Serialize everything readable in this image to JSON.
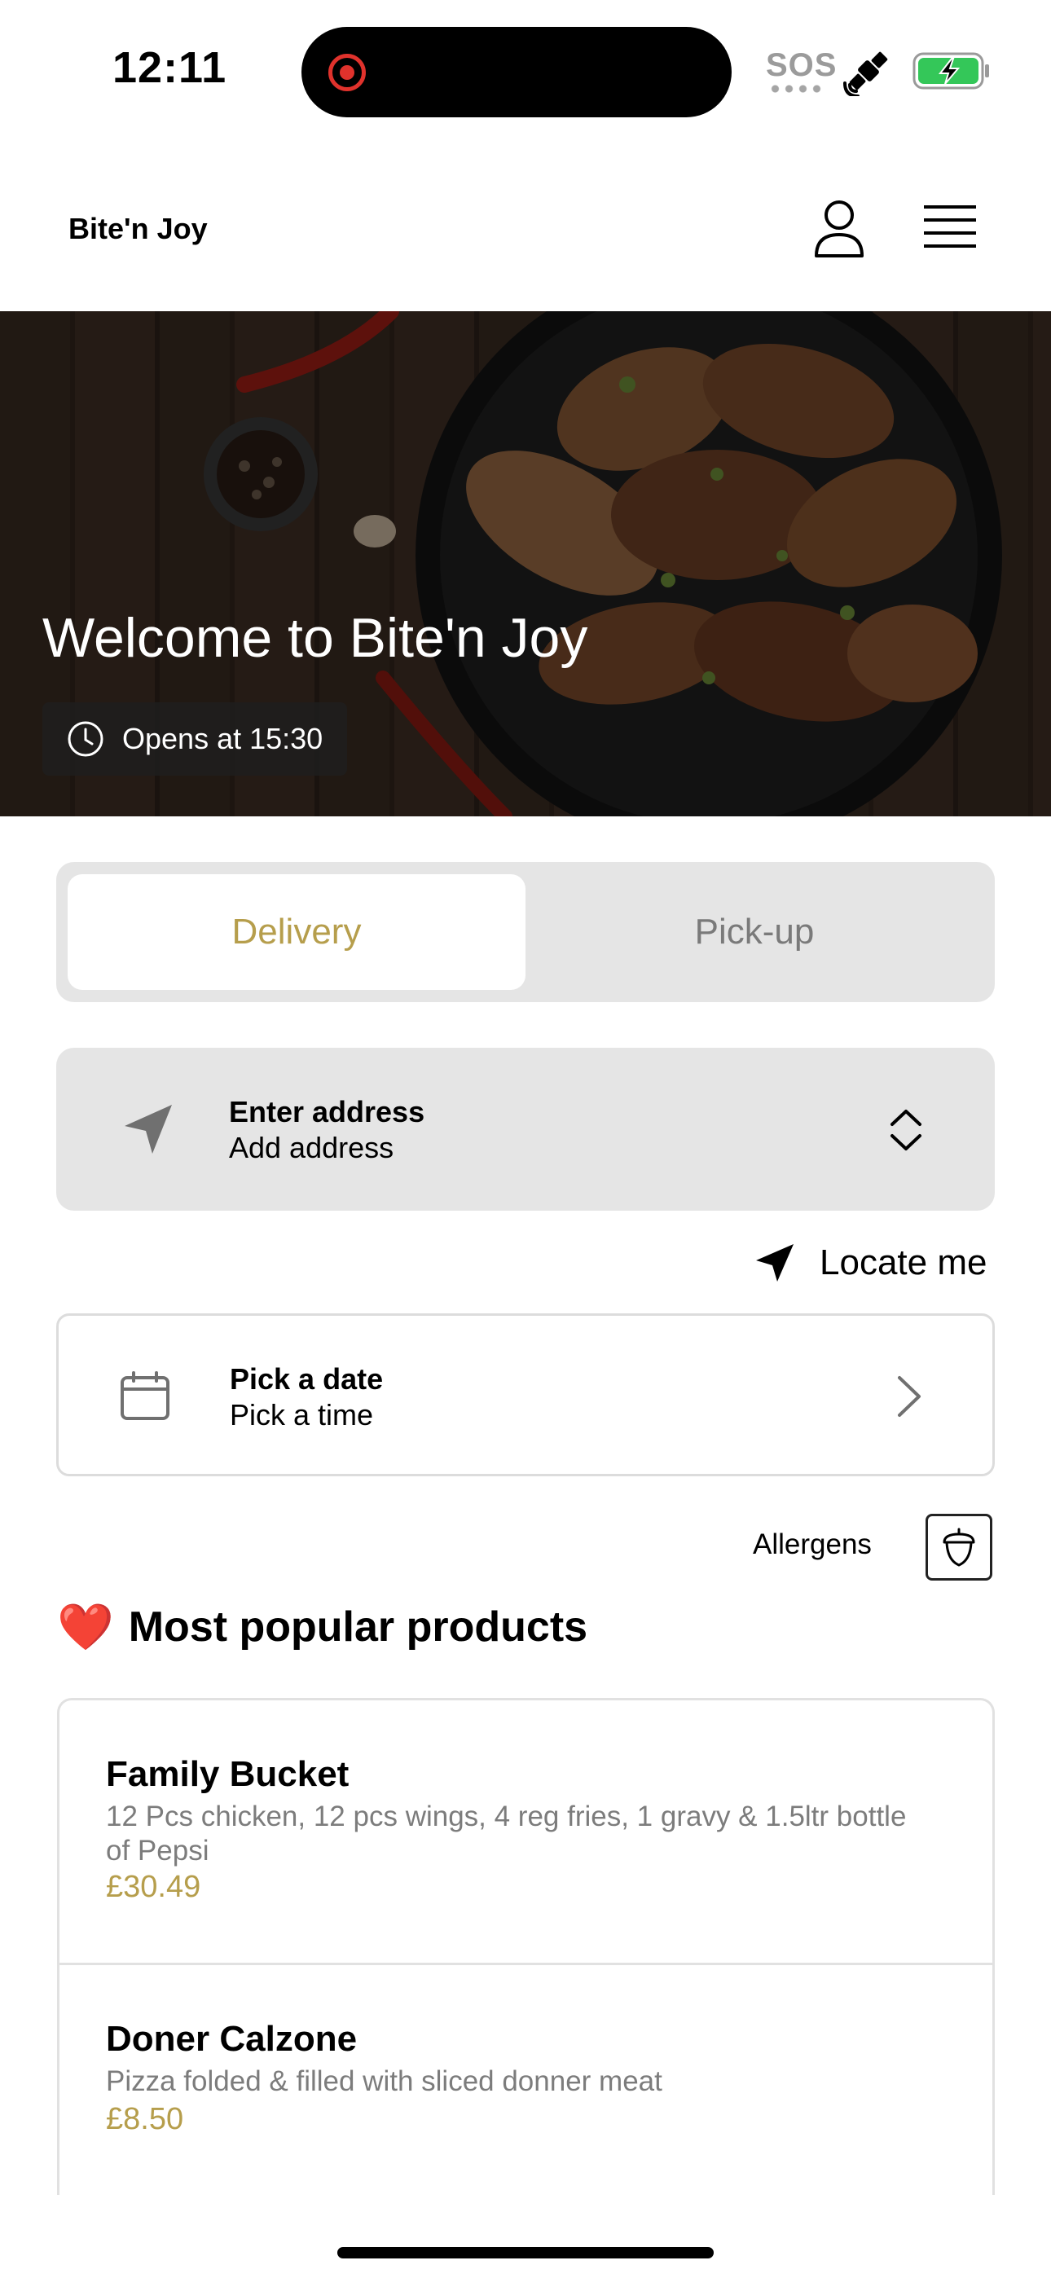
{
  "status_bar": {
    "time": "12:11",
    "sos": "SOS",
    "icons": [
      "screen-recording-icon",
      "satellite-icon",
      "battery-charging-icon"
    ]
  },
  "header": {
    "brand": "Bite'n Joy",
    "icons": [
      "user-icon",
      "menu-icon"
    ]
  },
  "hero": {
    "title": "Welcome to Bite'n Joy",
    "opens": "Opens at 15:30"
  },
  "mode_tabs": [
    {
      "label": "Delivery",
      "selected": true
    },
    {
      "label": "Pick-up",
      "selected": false
    }
  ],
  "address": {
    "title": "Enter address",
    "subtitle": "Add address"
  },
  "locate": {
    "label": "Locate me"
  },
  "schedule": {
    "title": "Pick a date",
    "subtitle": "Pick a time"
  },
  "allergens": {
    "label": "Allergens"
  },
  "popular": {
    "emoji": "❤️",
    "title": "Most popular products",
    "products": [
      {
        "name": "Family Bucket",
        "description": "12  Pcs chicken, 12 pcs wings, 4 reg fries, 1 gravy & 1.5ltr bottle of Pepsi",
        "price": "£30.49"
      },
      {
        "name": "Doner Calzone",
        "description": "Pizza folded & filled with sliced donner meat",
        "price": "£8.50"
      }
    ]
  },
  "colors": {
    "accent": "#b69e4c",
    "inactive_text": "#7a7a7a",
    "field_bg": "#e5e5e5",
    "recording": "#e0322c",
    "battery": "#34c759"
  }
}
